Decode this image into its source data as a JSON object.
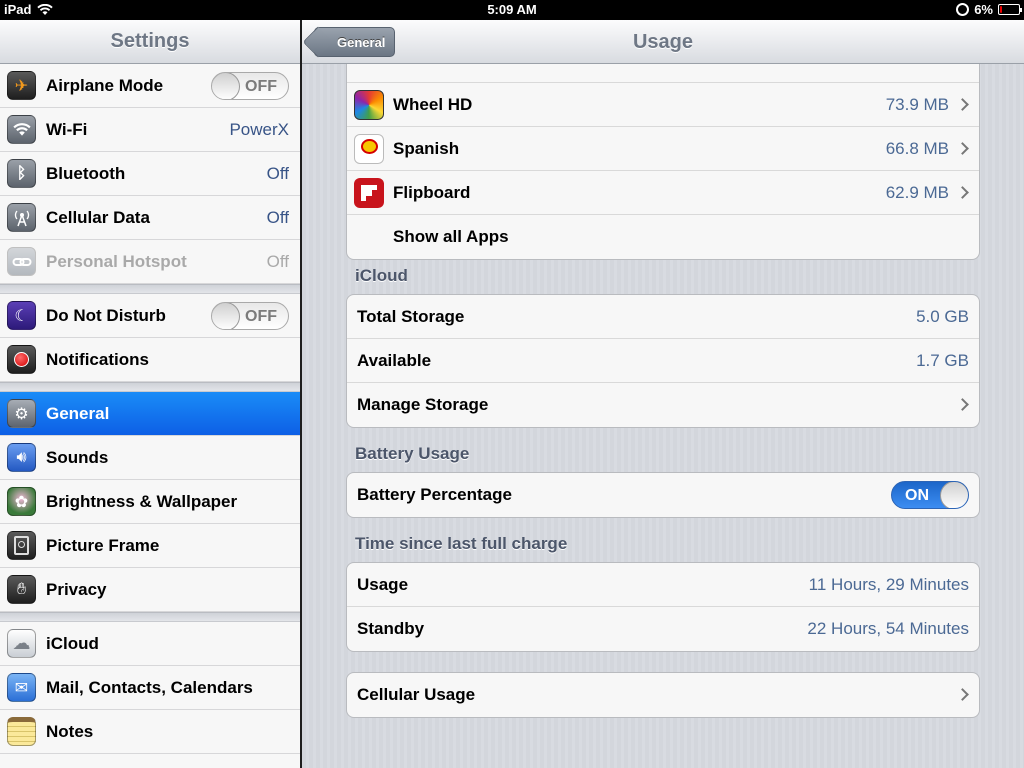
{
  "status": {
    "device": "iPad",
    "time": "5:09 AM",
    "battery": "6%"
  },
  "sidebar": {
    "title": "Settings",
    "groups": [
      [
        {
          "label": "Airplane Mode",
          "toggle": "OFF",
          "icon": "airplane-icon"
        },
        {
          "label": "Wi-Fi",
          "value": "PowerX",
          "icon": "wifi-icon"
        },
        {
          "label": "Bluetooth",
          "value": "Off",
          "icon": "bluetooth-icon"
        },
        {
          "label": "Cellular Data",
          "value": "Off",
          "icon": "cellular-icon"
        },
        {
          "label": "Personal Hotspot",
          "value": "Off",
          "icon": "hotspot-icon"
        }
      ],
      [
        {
          "label": "Do Not Disturb",
          "toggle": "OFF",
          "icon": "moon-icon"
        },
        {
          "label": "Notifications",
          "icon": "notifications-icon"
        }
      ],
      [
        {
          "label": "General",
          "icon": "gear-icon"
        },
        {
          "label": "Sounds",
          "icon": "speaker-icon"
        },
        {
          "label": "Brightness & Wallpaper",
          "icon": "flower-icon"
        },
        {
          "label": "Picture Frame",
          "icon": "picture-frame-icon"
        },
        {
          "label": "Privacy",
          "icon": "hand-icon"
        }
      ],
      [
        {
          "label": "iCloud",
          "icon": "cloud-icon"
        },
        {
          "label": "Mail, Contacts, Calendars",
          "icon": "mail-icon"
        },
        {
          "label": "Notes",
          "icon": "notes-icon"
        }
      ]
    ]
  },
  "detail": {
    "title": "Usage",
    "back_label": "General",
    "apps": [
      {
        "name": "Wheel HD",
        "size": "73.9 MB",
        "icon": "wheel-hd-icon"
      },
      {
        "name": "Spanish",
        "size": "66.8 MB",
        "icon": "babbel-icon"
      },
      {
        "name": "Flipboard",
        "size": "62.9 MB",
        "icon": "flipboard-icon"
      }
    ],
    "show_all": "Show all Apps",
    "icloud": {
      "header": "iCloud",
      "total_label": "Total Storage",
      "total_value": "5.0 GB",
      "available_label": "Available",
      "available_value": "1.7 GB",
      "manage_label": "Manage Storage"
    },
    "battery": {
      "header": "Battery Usage",
      "percentage_label": "Battery Percentage",
      "toggle": "ON"
    },
    "charge": {
      "header": "Time since last full charge",
      "usage_label": "Usage",
      "usage_value": "11 Hours, 29 Minutes",
      "standby_label": "Standby",
      "standby_value": "22 Hours, 54 Minutes"
    },
    "cellular_label": "Cellular Usage"
  }
}
